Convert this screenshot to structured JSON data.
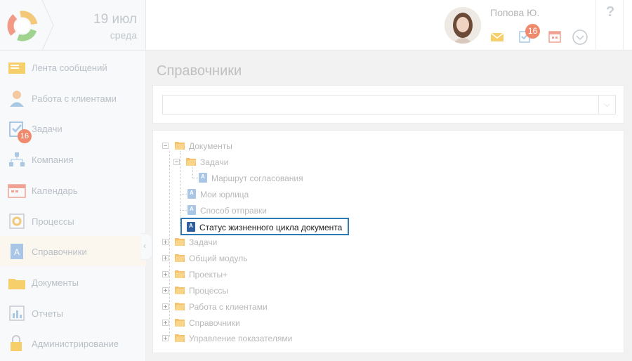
{
  "header": {
    "date_day": "19 июл",
    "date_weekday": "среда",
    "user_name": "Попова Ю.",
    "tasks_badge": "16",
    "help": "?"
  },
  "sidebar": {
    "items": [
      {
        "label": "Лента сообщений",
        "icon": "feed-icon"
      },
      {
        "label": "Работа с клиентами",
        "icon": "clients-icon"
      },
      {
        "label": "Задачи",
        "icon": "tasks-icon",
        "badge": "16"
      },
      {
        "label": "Компания",
        "icon": "company-icon"
      },
      {
        "label": "Календарь",
        "icon": "calendar-icon"
      },
      {
        "label": "Процессы",
        "icon": "processes-icon"
      },
      {
        "label": "Справочники",
        "icon": "directories-icon",
        "active": true
      },
      {
        "label": "Документы",
        "icon": "documents-icon"
      },
      {
        "label": "Отчеты",
        "icon": "reports-icon"
      },
      {
        "label": "Администрирование",
        "icon": "admin-icon"
      }
    ]
  },
  "main": {
    "title": "Справочники",
    "filter_value": "",
    "tree": [
      {
        "label": "Документы",
        "type": "folder",
        "level": 0,
        "expanded": true
      },
      {
        "label": "Задачи",
        "type": "folder",
        "level": 1,
        "expanded": true
      },
      {
        "label": "Маршрут согласования",
        "type": "doc",
        "level": 2
      },
      {
        "label": "Мои юрлица",
        "type": "doc",
        "level": 1
      },
      {
        "label": "Способ отправки",
        "type": "doc",
        "level": 1
      },
      {
        "label": "Статус жизненного цикла документа",
        "type": "doc",
        "level": 1,
        "selected": true
      },
      {
        "label": "Задачи",
        "type": "folder",
        "level": 0
      },
      {
        "label": "Общий модуль",
        "type": "folder",
        "level": 0
      },
      {
        "label": "Проекты+",
        "type": "folder",
        "level": 0
      },
      {
        "label": "Процессы",
        "type": "folder",
        "level": 0
      },
      {
        "label": "Работа с клиентами",
        "type": "folder",
        "level": 0
      },
      {
        "label": "Справочники",
        "type": "folder",
        "level": 0
      },
      {
        "label": "Управление показателями",
        "type": "folder",
        "level": 0
      }
    ]
  },
  "colors": {
    "accent": "#2b79b5",
    "badge": "#f08a6f",
    "folder": "#f5c26b"
  }
}
